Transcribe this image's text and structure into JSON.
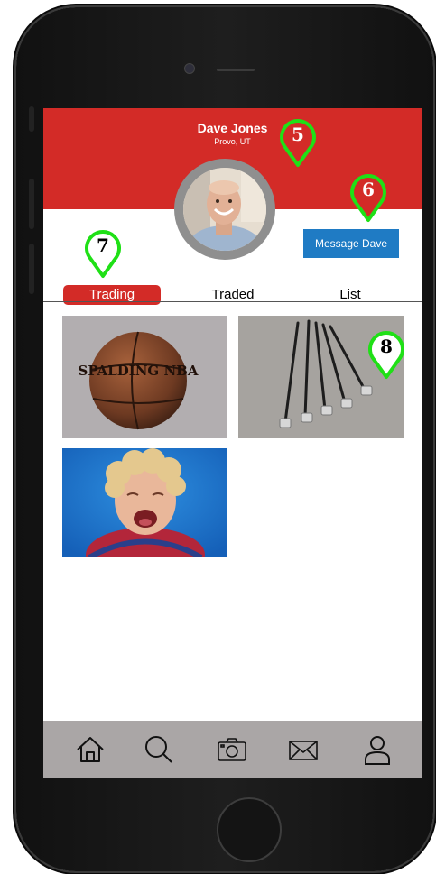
{
  "profile": {
    "name": "Dave Jones",
    "location": "Provo, UT",
    "message_label": "Message Dave"
  },
  "tabs": [
    {
      "label": "Trading",
      "active": true
    },
    {
      "label": "Traded",
      "active": false
    },
    {
      "label": "List",
      "active": false
    }
  ],
  "items": [
    {
      "image": "basketball-photo",
      "label": "SPALDING NBA"
    },
    {
      "image": "golf-clubs-photo"
    },
    {
      "image": "crying-child-photo"
    }
  ],
  "bottom_nav": [
    {
      "icon": "home-icon"
    },
    {
      "icon": "search-icon"
    },
    {
      "icon": "camera-icon"
    },
    {
      "icon": "mail-icon"
    },
    {
      "icon": "user-icon"
    }
  ],
  "annotations": [
    "5",
    "6",
    "7",
    "8"
  ],
  "colors": {
    "brand_red": "#d32b27",
    "button_blue": "#1f7bc4",
    "tabbar_gray": "#aaa6a6",
    "marker_green": "#1fe016"
  }
}
